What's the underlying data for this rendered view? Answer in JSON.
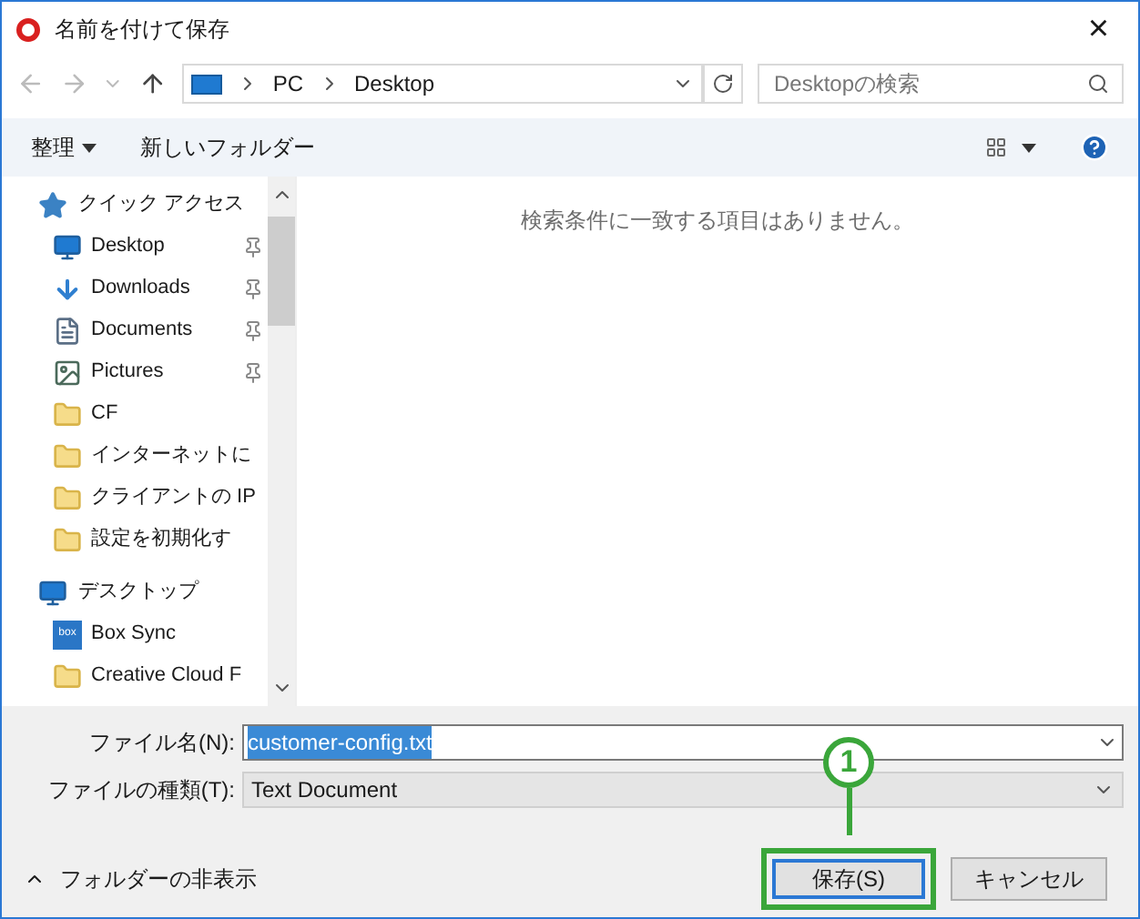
{
  "window": {
    "title": "名前を付けて保存",
    "close": "×"
  },
  "address": {
    "crumbs": [
      "PC",
      "Desktop"
    ]
  },
  "search": {
    "placeholder": "Desktopの検索"
  },
  "toolbar": {
    "organize": "整理",
    "new_folder": "新しいフォルダー"
  },
  "sidebar": {
    "groups": [
      {
        "label": "クイック アクセス",
        "kind": "star",
        "children": [
          {
            "label": "Desktop",
            "kind": "desktop",
            "pinned": true
          },
          {
            "label": "Downloads",
            "kind": "download",
            "pinned": true
          },
          {
            "label": "Documents",
            "kind": "document",
            "pinned": true
          },
          {
            "label": "Pictures",
            "kind": "picture",
            "pinned": true
          },
          {
            "label": "CF",
            "kind": "folder",
            "pinned": false
          },
          {
            "label": "インターネットに",
            "kind": "folder",
            "pinned": false
          },
          {
            "label": "クライアントの IP",
            "kind": "folder",
            "pinned": false
          },
          {
            "label": "設定を初期化す",
            "kind": "folder",
            "pinned": false
          }
        ]
      },
      {
        "label": "デスクトップ",
        "kind": "desktop",
        "children": [
          {
            "label": "Box Sync",
            "kind": "box",
            "pinned": false
          },
          {
            "label": "Creative Cloud F",
            "kind": "folder",
            "pinned": false
          }
        ]
      }
    ]
  },
  "content": {
    "empty_message": "検索条件に一致する項目はありません。"
  },
  "form": {
    "filename_label": "ファイル名(N):",
    "filename": "customer-config.txt",
    "type_label": "ファイルの種類(T):",
    "type": "Text Document"
  },
  "footer": {
    "hide_folders": "フォルダーの非表示",
    "save": "保存(S)",
    "cancel": "キャンセル"
  },
  "callout": {
    "number": "1"
  }
}
